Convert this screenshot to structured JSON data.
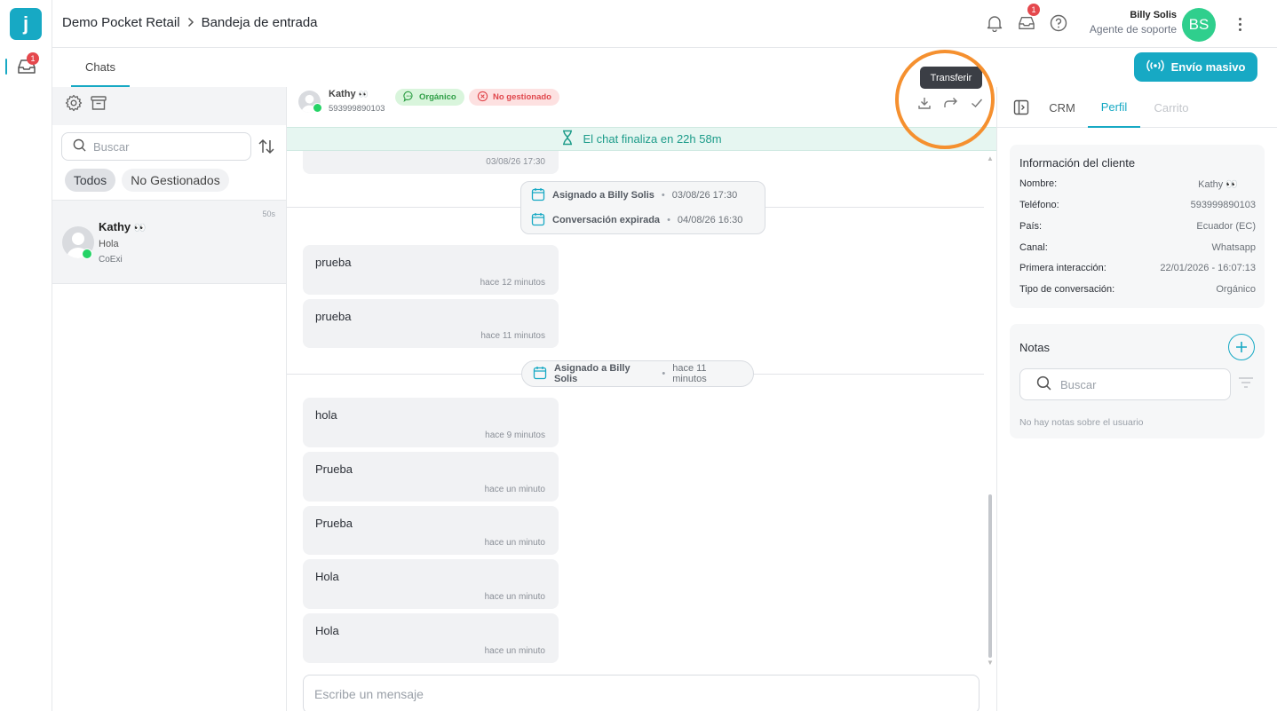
{
  "app": {
    "logo_letter": "j"
  },
  "rail": {
    "inbox_badge": "1"
  },
  "header": {
    "workspace": "Demo Pocket Retail",
    "separator": ">",
    "page": "Bandeja de entrada",
    "inbox_badge": "1",
    "user_name": "Billy Solis",
    "user_role": "Agente de soporte",
    "user_initials": "BS"
  },
  "subheader": {
    "tab_chats": "Chats",
    "broadcast_button": "Envío masivo"
  },
  "left_panel": {
    "search_placeholder": "Buscar",
    "filters": [
      "Todos",
      "No Gestionados"
    ],
    "chat": {
      "name": "Kathy",
      "emoji": "👀",
      "preview": "Hola",
      "channel": "CoExi",
      "age": "50s"
    }
  },
  "chat_header": {
    "name": "Kathy",
    "emoji": "👀",
    "phone": "593999890103",
    "tag_organic": "Orgánico",
    "tag_unmanaged": "No gestionado",
    "tooltip": "Transferir",
    "timer_text": "El chat finaliza en 22h 58m"
  },
  "messages": {
    "top_partial_time": "03/08/26 17:30",
    "events_1": [
      {
        "label": "Asignado a Billy Solis",
        "time": "03/08/26 17:30"
      },
      {
        "label": "Conversación expirada",
        "time": "04/08/26 16:30"
      }
    ],
    "group_1": [
      {
        "text": "prueba",
        "time": "hace 12 minutos"
      },
      {
        "text": "prueba",
        "time": "hace 11 minutos"
      }
    ],
    "event_2": {
      "label": "Asignado a Billy Solis",
      "time": "hace 11 minutos"
    },
    "group_2": [
      {
        "text": "hola",
        "time": "hace 9 minutos"
      },
      {
        "text": "Prueba",
        "time": "hace un minuto"
      },
      {
        "text": "Prueba",
        "time": "hace un minuto"
      },
      {
        "text": "Hola",
        "time": "hace un minuto"
      },
      {
        "text": "Hola",
        "time": "hace un minuto"
      }
    ],
    "composer_placeholder": "Escribe un mensaje"
  },
  "right_panel": {
    "tabs": [
      "CRM",
      "Perfil",
      "Carrito"
    ],
    "active_tab": "Perfil",
    "info_title": "Información del cliente",
    "info_rows": [
      {
        "key": "Nombre:",
        "value": "Kathy 👀"
      },
      {
        "key": "Teléfono:",
        "value": "593999890103"
      },
      {
        "key": "País:",
        "value": "Ecuador (EC)"
      },
      {
        "key": "Canal:",
        "value": "Whatsapp"
      },
      {
        "key": "Primera interacción:",
        "value": "22/01/2026 - 16:07:13"
      },
      {
        "key": "Tipo de conversación:",
        "value": "Orgánico"
      }
    ],
    "notes_title": "Notas",
    "notes_search_placeholder": "Buscar",
    "notes_empty": "No hay notas sobre el usuario"
  },
  "colors": {
    "accent": "#17a9c4",
    "avatar_green": "#2fcf8d",
    "highlight": "#f5902f",
    "badge_red": "#e5484d"
  }
}
